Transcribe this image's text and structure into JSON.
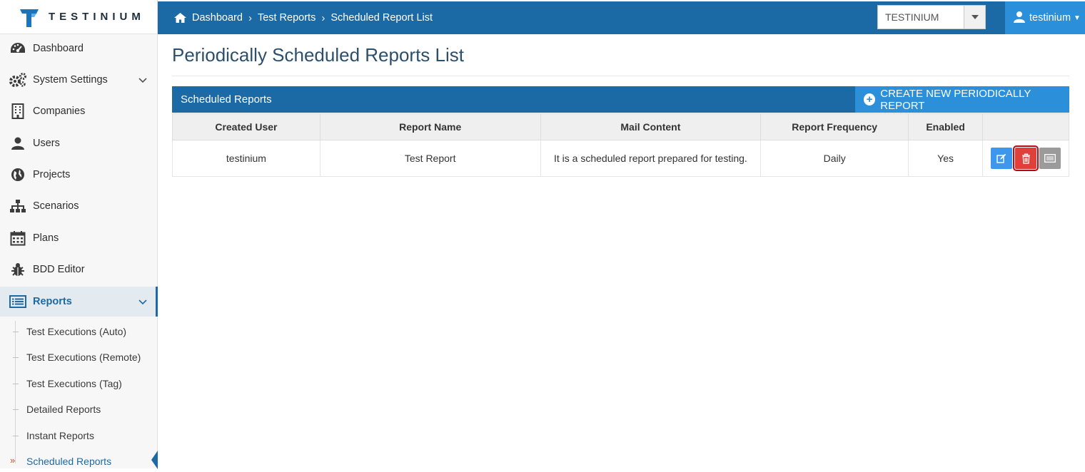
{
  "brand": {
    "name": "TESTINIUM"
  },
  "sidebar": {
    "items": [
      {
        "label": "Dashboard",
        "icon": "dashboard-icon"
      },
      {
        "label": "System Settings",
        "icon": "gears-icon"
      },
      {
        "label": "Companies",
        "icon": "building-icon"
      },
      {
        "label": "Users",
        "icon": "user-icon"
      },
      {
        "label": "Projects",
        "icon": "globe-icon"
      },
      {
        "label": "Scenarios",
        "icon": "sitemap-icon"
      },
      {
        "label": "Plans",
        "icon": "calendar-icon"
      },
      {
        "label": "BDD Editor",
        "icon": "bug-icon"
      },
      {
        "label": "Reports",
        "icon": "list-alt-icon"
      }
    ],
    "report_subitems": [
      {
        "label": "Test Executions (Auto)"
      },
      {
        "label": "Test Executions (Remote)"
      },
      {
        "label": "Test Executions (Tag)"
      },
      {
        "label": "Detailed Reports"
      },
      {
        "label": "Instant Reports"
      },
      {
        "label": "Scheduled Reports"
      }
    ]
  },
  "breadcrumb": [
    "Dashboard",
    "Test Reports",
    "Scheduled Report List"
  ],
  "company_select": {
    "value": "TESTINIUM"
  },
  "user_menu": {
    "username": "testinium"
  },
  "page": {
    "title": "Periodically Scheduled Reports List"
  },
  "panel": {
    "title": "Scheduled Reports",
    "create_button": "CREATE NEW PERIODICALLY REPORT"
  },
  "table": {
    "headers": [
      "Created User",
      "Report Name",
      "Mail Content",
      "Report Frequency",
      "Enabled",
      ""
    ],
    "rows": [
      [
        "testinium",
        "Test Report",
        "It is a scheduled report prepared for testing.",
        "Daily",
        "Yes"
      ]
    ]
  },
  "colors": {
    "primary": "#1b6aa6",
    "accent": "#2b8fd9",
    "danger": "#e0403a",
    "edit": "#3d97ec",
    "neutral": "#9b9b9b"
  }
}
